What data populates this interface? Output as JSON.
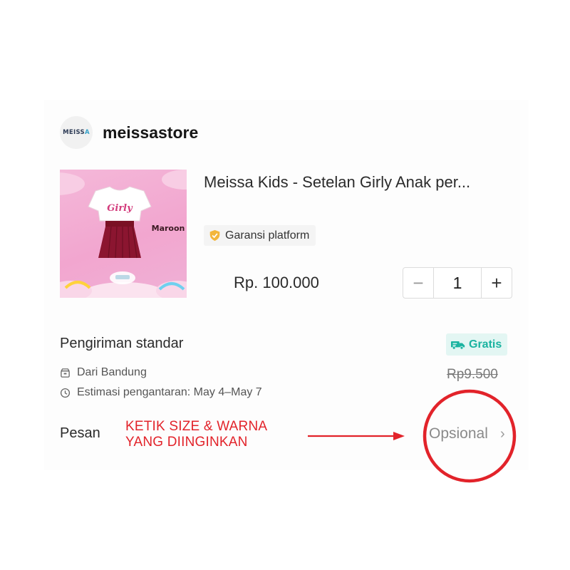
{
  "store": {
    "logo_text_main": "MEISS",
    "logo_text_accent": "A",
    "name": "meissastore"
  },
  "product": {
    "title": "Meissa Kids - Setelan Girly Anak per...",
    "image": {
      "shirt_text": "Girly",
      "color_label": "Maroon"
    },
    "badge": "Garansi platform",
    "price": "Rp. 100.000",
    "quantity": "1",
    "minus_symbol": "−",
    "plus_symbol": "+"
  },
  "shipping": {
    "title": "Pengiriman standar",
    "badge": "Gratis",
    "from": "Dari Bandung",
    "estimate": "Estimasi pengantaran: May 4–May 7",
    "old_price": "Rp9.500"
  },
  "message": {
    "label": "Pesan",
    "value": "Opsional",
    "chevron": "›"
  },
  "annotation": {
    "line1": "KETIK SIZE & WARNA",
    "line2": "YANG DIINGINKAN",
    "color": "#e2232a"
  },
  "colors": {
    "accent_teal": "#1ab3a0",
    "gratis_bg": "#e3f6f3",
    "shield": "#f3b63b",
    "image_bg": "#f2a6cf"
  },
  "icons": [
    "shield-check-icon",
    "truck-icon",
    "store-box-icon",
    "clock-icon",
    "chevron-right-icon"
  ]
}
